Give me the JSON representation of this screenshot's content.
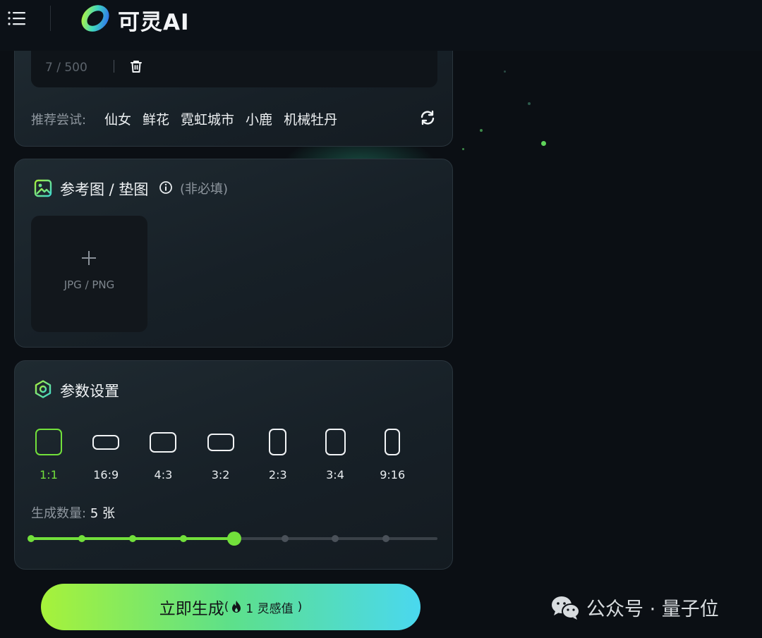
{
  "header": {
    "brand": "可灵AI"
  },
  "prompt": {
    "char_count": "7 / 500",
    "suggest_label": "推荐尝试:",
    "suggestions": [
      "仙女",
      "鲜花",
      "霓虹城市",
      "小鹿",
      "机械牡丹"
    ]
  },
  "reference": {
    "title": "参考图 / 垫图",
    "optional": "(非必填)",
    "upload_hint": "JPG / PNG"
  },
  "params": {
    "title": "参数设置",
    "ratios": [
      {
        "label": "1:1",
        "w": 1,
        "h": 1,
        "active": true
      },
      {
        "label": "16:9",
        "w": 16,
        "h": 9,
        "active": false
      },
      {
        "label": "4:3",
        "w": 4,
        "h": 3,
        "active": false
      },
      {
        "label": "3:2",
        "w": 3,
        "h": 2,
        "active": false
      },
      {
        "label": "2:3",
        "w": 2,
        "h": 3,
        "active": false
      },
      {
        "label": "3:4",
        "w": 3,
        "h": 4,
        "active": false
      },
      {
        "label": "9:16",
        "w": 9,
        "h": 16,
        "active": false
      }
    ],
    "quantity_label": "生成数量:",
    "quantity_value": "5 张",
    "quantity": 5,
    "quantity_max": 9
  },
  "generate": {
    "label": "立即生成",
    "cost_open": "(",
    "cost_text": "1 灵感值",
    "cost_close": ")"
  },
  "watermark": {
    "text": "公众号 · 量子位"
  },
  "colors": {
    "accent": "#72e03b",
    "background": "#0b0f14",
    "panel": "#1a242b"
  }
}
